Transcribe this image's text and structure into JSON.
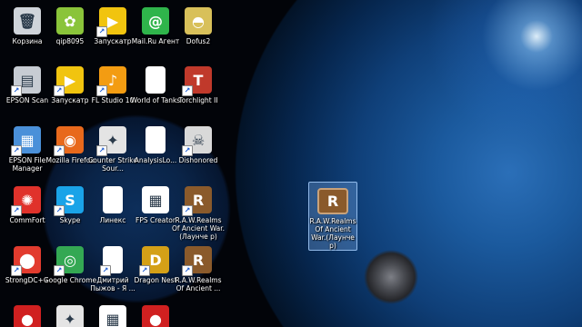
{
  "desktop": {
    "icons": [
      {
        "label": "Корзина",
        "icon": "recycle-bin-icon",
        "color": "#cfd4da",
        "glyph": "🗑",
        "shortcut": false
      },
      {
        "label": "qip8095",
        "icon": "qip-icon",
        "color": "#8ac43a",
        "glyph": "✿",
        "shortcut": false
      },
      {
        "label": "Запускатр",
        "icon": "launcher-icon",
        "color": "#f1c40f",
        "glyph": "▶",
        "shortcut": true
      },
      {
        "label": "Mail.Ru Агент",
        "icon": "mailru-agent-icon",
        "color": "#2fb44b",
        "glyph": "@",
        "shortcut": false
      },
      {
        "label": "Dofus2",
        "icon": "dofus-icon",
        "color": "#d8c05a",
        "glyph": "◓",
        "shortcut": false
      },
      {
        "label": "EPSON Scan",
        "icon": "epson-scan-icon",
        "color": "#c7ccd3",
        "glyph": "▤",
        "shortcut": true
      },
      {
        "label": "Запускатр",
        "icon": "launcher-icon",
        "color": "#f1c40f",
        "glyph": "▶",
        "shortcut": true
      },
      {
        "label": "FL Studio 10",
        "icon": "fl-studio-icon",
        "color": "#f39c12",
        "glyph": "♪",
        "shortcut": true
      },
      {
        "label": "World of Tanks",
        "icon": "document-icon",
        "color": "#ffffff",
        "glyph": "",
        "shortcut": false
      },
      {
        "label": "Torchlight II",
        "icon": "torchlight-icon",
        "color": "#c0392b",
        "glyph": "T",
        "shortcut": true
      },
      {
        "label": "EPSON File Manager",
        "icon": "epson-file-manager-icon",
        "color": "#4a90d9",
        "glyph": "▦",
        "shortcut": true
      },
      {
        "label": "Mozilla Firefox",
        "icon": "firefox-icon",
        "color": "#e8691c",
        "glyph": "◉",
        "shortcut": true
      },
      {
        "label": "Counter Strike Sour...",
        "icon": "counter-strike-icon",
        "color": "#e4e4e4",
        "glyph": "✦",
        "shortcut": true
      },
      {
        "label": "AnalysisLo...",
        "icon": "document-icon",
        "color": "#ffffff",
        "glyph": "",
        "shortcut": false
      },
      {
        "label": "Dishonored",
        "icon": "dishonored-icon",
        "color": "#d9d9d9",
        "glyph": "☠",
        "shortcut": true
      },
      {
        "label": "CommFort",
        "icon": "commfort-icon",
        "color": "#e0322b",
        "glyph": "✺",
        "shortcut": true
      },
      {
        "label": "Skype",
        "icon": "skype-icon",
        "color": "#1aa3e8",
        "glyph": "S",
        "shortcut": true
      },
      {
        "label": "Линекс",
        "icon": "document-icon",
        "color": "#ffffff",
        "glyph": "",
        "shortcut": false
      },
      {
        "label": "FPS Creator",
        "icon": "fps-creator-icon",
        "color": "#ffffff",
        "glyph": "▦",
        "shortcut": false
      },
      {
        "label": "R.A.W.Realms Of Ancient War.(Лаунче р)",
        "icon": "raw-game-icon",
        "color": "#8a5a2b",
        "glyph": "R",
        "shortcut": true
      },
      {
        "label": "StrongDC++",
        "icon": "strongdc-icon",
        "color": "#e23b2e",
        "glyph": "⬤",
        "shortcut": true
      },
      {
        "label": "Google Chrome",
        "icon": "chrome-icon",
        "color": "#34a853",
        "glyph": "◎",
        "shortcut": true
      },
      {
        "label": "Дмитрий Пыжов - Я ...",
        "icon": "document-icon",
        "color": "#ffffff",
        "glyph": "",
        "shortcut": true
      },
      {
        "label": "Dragon Nest",
        "icon": "dragon-nest-icon",
        "color": "#d4a017",
        "glyph": "D",
        "shortcut": true
      },
      {
        "label": "R.A.W.Realms Of Ancient ...",
        "icon": "raw-game-icon",
        "color": "#8a5a2b",
        "glyph": "R",
        "shortcut": true
      },
      {
        "label": "",
        "icon": "red-app-icon",
        "color": "#d02020",
        "glyph": "●",
        "shortcut": false
      },
      {
        "label": "",
        "icon": "counter-strike-icon",
        "color": "#e4e4e4",
        "glyph": "✦",
        "shortcut": false
      },
      {
        "label": "",
        "icon": "generic-app-icon",
        "color": "#ffffff",
        "glyph": "▦",
        "shortcut": false
      },
      {
        "label": "",
        "icon": "red-app-icon",
        "color": "#d02020",
        "glyph": "●",
        "shortcut": false
      }
    ],
    "selected_icon": {
      "label": "R.A.W.Realms Of Ancient War.(Лаунче р)",
      "icon": "raw-game-icon",
      "color": "#8a5a2b",
      "glyph": "R"
    }
  }
}
